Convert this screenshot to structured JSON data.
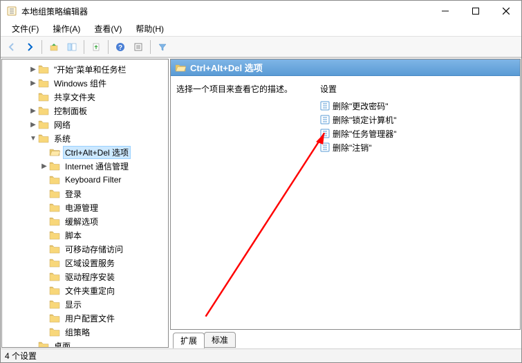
{
  "window": {
    "title": "本地组策略编辑器"
  },
  "menubar": {
    "file": "文件(F)",
    "action": "操作(A)",
    "view": "查看(V)",
    "help": "帮助(H)"
  },
  "tree": {
    "items": [
      {
        "indent": 2,
        "exp": "▶",
        "label": "\"开始\"菜单和任务栏"
      },
      {
        "indent": 2,
        "exp": "▶",
        "label": "Windows 组件"
      },
      {
        "indent": 2,
        "exp": "",
        "label": "共享文件夹"
      },
      {
        "indent": 2,
        "exp": "▶",
        "label": "控制面板"
      },
      {
        "indent": 2,
        "exp": "▶",
        "label": "网络"
      },
      {
        "indent": 2,
        "exp": "▼",
        "label": "系统"
      },
      {
        "indent": 3,
        "exp": "",
        "label": "Ctrl+Alt+Del 选项",
        "selected": true
      },
      {
        "indent": 3,
        "exp": "▶",
        "label": "Internet 通信管理"
      },
      {
        "indent": 3,
        "exp": "",
        "label": "Keyboard Filter"
      },
      {
        "indent": 3,
        "exp": "",
        "label": "登录"
      },
      {
        "indent": 3,
        "exp": "",
        "label": "电源管理"
      },
      {
        "indent": 3,
        "exp": "",
        "label": "缓解选项"
      },
      {
        "indent": 3,
        "exp": "",
        "label": "脚本"
      },
      {
        "indent": 3,
        "exp": "",
        "label": "可移动存储访问"
      },
      {
        "indent": 3,
        "exp": "",
        "label": "区域设置服务"
      },
      {
        "indent": 3,
        "exp": "",
        "label": "驱动程序安装"
      },
      {
        "indent": 3,
        "exp": "",
        "label": "文件夹重定向"
      },
      {
        "indent": 3,
        "exp": "",
        "label": "显示"
      },
      {
        "indent": 3,
        "exp": "",
        "label": "用户配置文件"
      },
      {
        "indent": 3,
        "exp": "",
        "label": "组策略"
      },
      {
        "indent": 2,
        "exp": "",
        "label": "桌面"
      }
    ]
  },
  "details": {
    "header": "Ctrl+Alt+Del 选项",
    "description": "选择一个项目来查看它的描述。",
    "settings_header": "设置",
    "settings": [
      {
        "label": "删除\"更改密码\""
      },
      {
        "label": "删除\"锁定计算机\""
      },
      {
        "label": "删除\"任务管理器\""
      },
      {
        "label": "删除\"注销\""
      }
    ]
  },
  "tabs": {
    "extended": "扩展",
    "standard": "标准"
  },
  "statusbar": {
    "text": "4 个设置"
  }
}
